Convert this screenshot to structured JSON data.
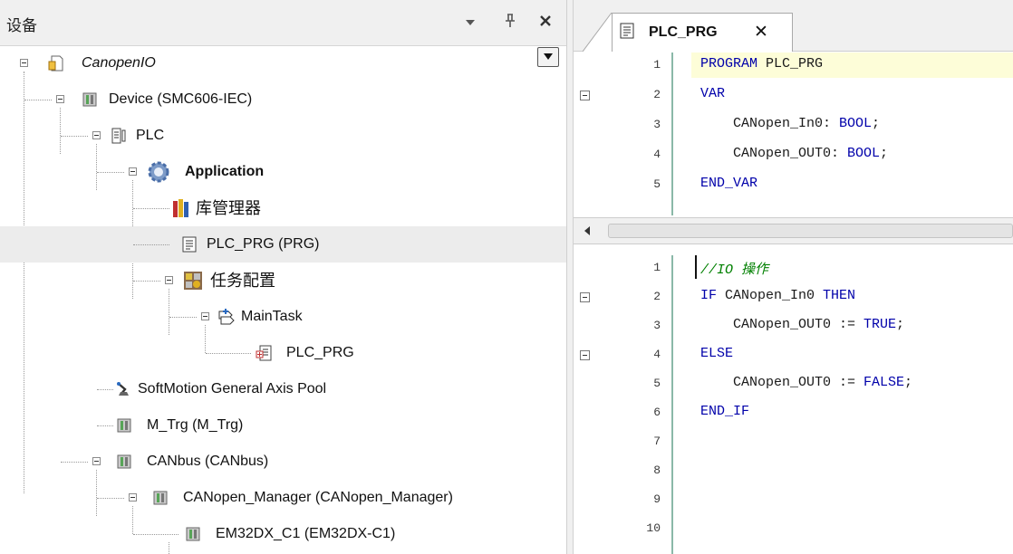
{
  "device_panel": {
    "title": "设备",
    "tree": [
      {
        "label": "CanopenIO"
      },
      {
        "label": "Device (SMC606-IEC)"
      },
      {
        "label": "PLC"
      },
      {
        "label": "Application"
      },
      {
        "label": "库管理器"
      },
      {
        "label": "PLC_PRG (PRG)"
      },
      {
        "label": "任务配置"
      },
      {
        "label": "MainTask"
      },
      {
        "label": "PLC_PRG"
      },
      {
        "label": "SoftMotion General Axis Pool"
      },
      {
        "label": "M_Trg (M_Trg)"
      },
      {
        "label": "CANbus (CANbus)"
      },
      {
        "label": "CANopen_Manager (CANopen_Manager)"
      },
      {
        "label": "EM32DX_C1 (EM32DX-C1)"
      }
    ]
  },
  "editor": {
    "tab_label": "PLC_PRG",
    "decl_line_numbers": [
      "1",
      "2",
      "3",
      "4",
      "5"
    ],
    "decl_lines": [
      "PROGRAM PLC_PRG",
      "VAR",
      "    CANopen_In0: BOOL;",
      "    CANopen_OUT0: BOOL;",
      "END_VAR"
    ],
    "impl_line_numbers": [
      "1",
      "2",
      "3",
      "4",
      "5",
      "6",
      "7",
      "8",
      "9",
      "10"
    ],
    "impl_lines": [
      "//IO 操作",
      "IF CANopen_In0 THEN",
      "    CANopen_OUT0 := TRUE;",
      "ELSE",
      "    CANopen_OUT0 := FALSE;",
      "END_IF",
      "",
      "",
      "",
      ""
    ]
  },
  "colors": {
    "keyword": "#0000aa",
    "comment": "#008000",
    "selection": "#ececec",
    "declaration_highlight": "#fdfdd8"
  },
  "icons": [
    "pin-icon",
    "close-icon",
    "project-icon",
    "device-icon",
    "plc-icon",
    "application-gear-icon",
    "library-icon",
    "pou-icon",
    "task-config-icon",
    "task-icon",
    "task-pou-icon",
    "axis-pool-icon",
    "collapse-toggle-icon",
    "dropdown-arrow-icon"
  ]
}
